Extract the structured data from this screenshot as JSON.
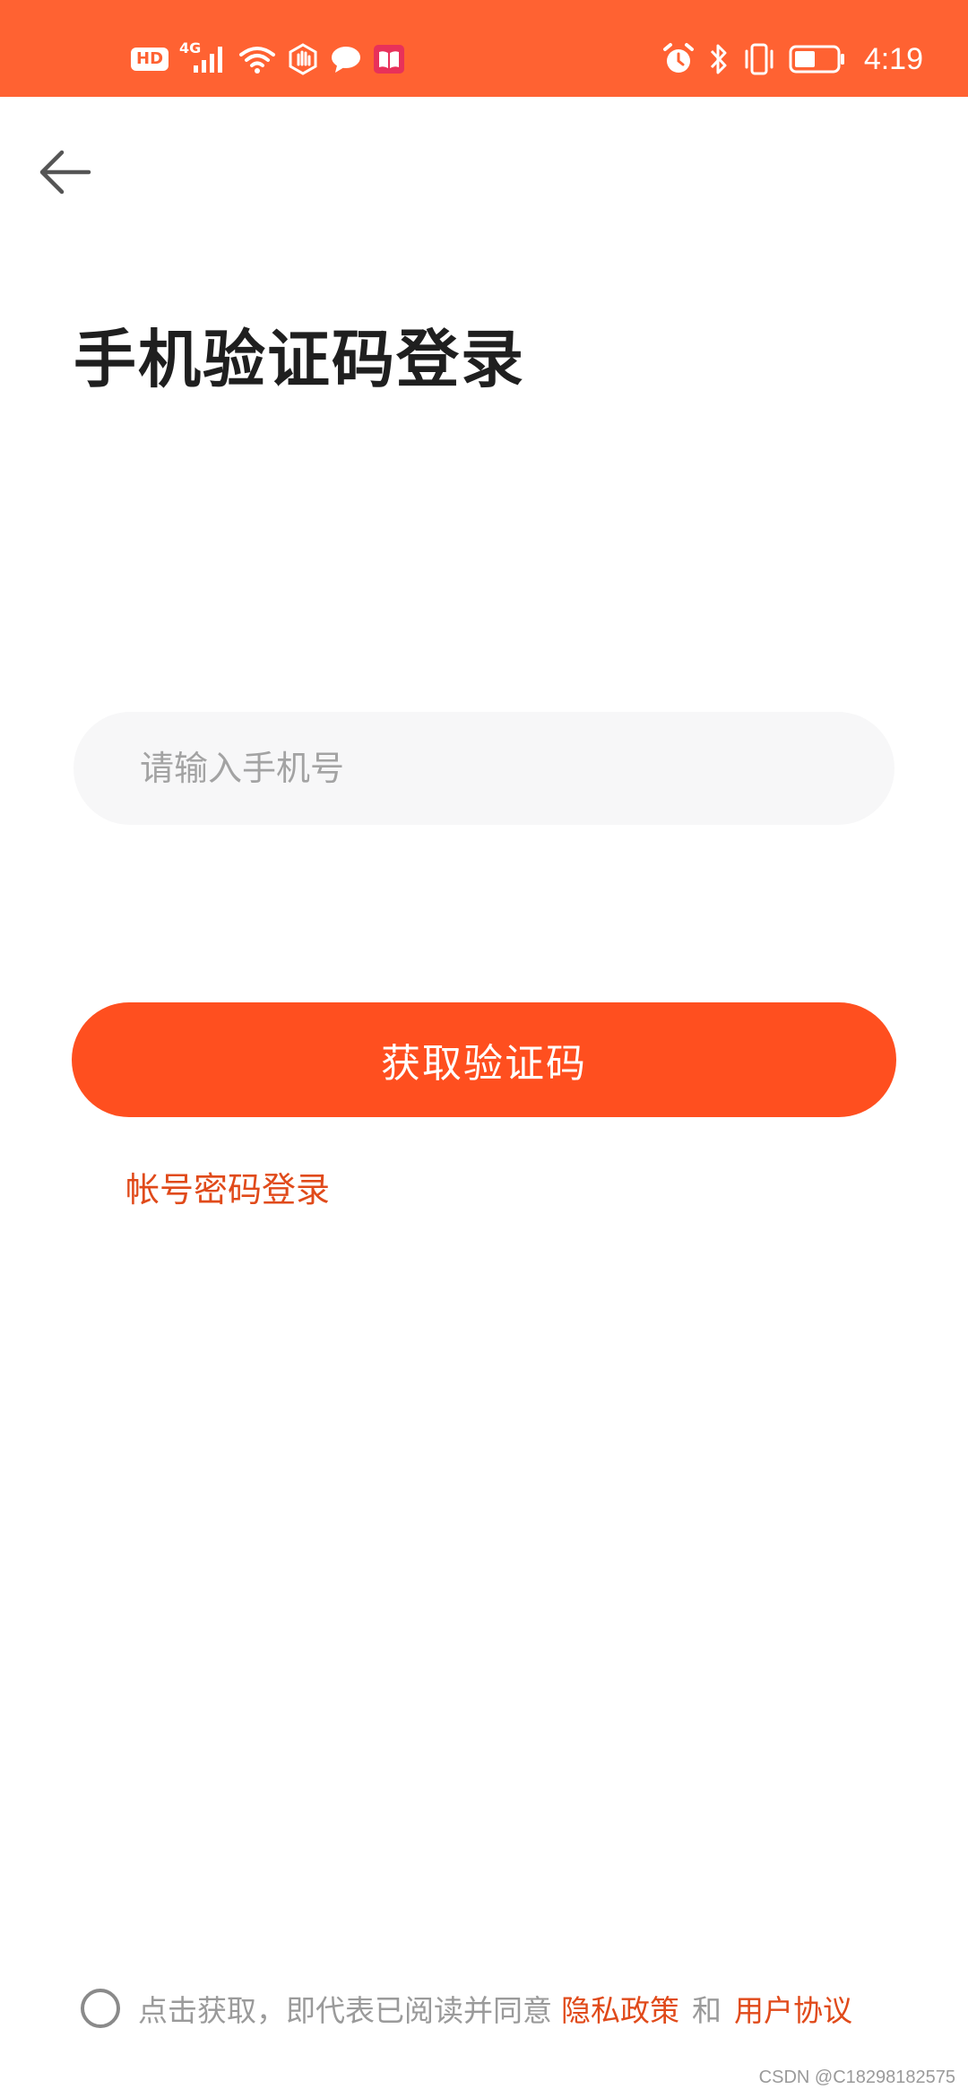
{
  "status_bar": {
    "hd_label": "HD",
    "network_label": "4G",
    "time": "4:19",
    "icons_left": [
      "hd-icon",
      "signal-icon",
      "wifi-icon",
      "hand-icon",
      "chat-icon",
      "book-icon"
    ],
    "icons_right": [
      "alarm-icon",
      "bluetooth-icon",
      "vibrate-icon",
      "battery-icon"
    ],
    "battery_level_percent": 50,
    "colors": {
      "background": "#ff6232",
      "foreground": "#ffffff"
    }
  },
  "header": {
    "back_icon": "arrow-left-icon"
  },
  "main": {
    "title": "手机验证码登录",
    "phone_input": {
      "value": "",
      "placeholder": "请输入手机号"
    },
    "get_code_button_label": "获取验证码",
    "password_login_link": "帐号密码登录"
  },
  "footer": {
    "agreement": {
      "checked": false,
      "prefix_text": "点击获取，即代表已阅读并同意",
      "privacy_link": "隐私政策",
      "and_text": "和",
      "terms_link": "用户协议"
    },
    "watermark": "CSDN @C18298182575"
  },
  "colors": {
    "accent": "#ff4f1f",
    "link": "#e04a1a",
    "title": "#1f1f1f",
    "muted_text": "#9a9a9a",
    "input_background": "#f7f7f8"
  }
}
